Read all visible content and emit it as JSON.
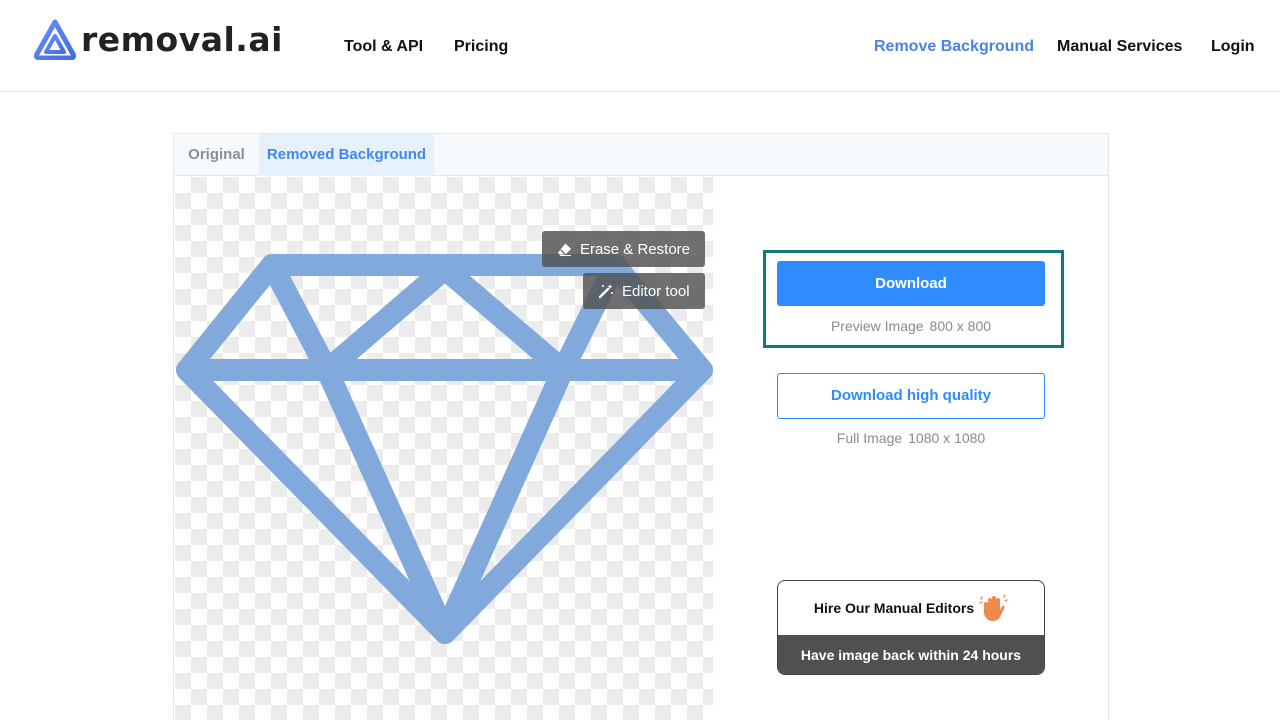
{
  "brand": {
    "logo_text": "removal.ai",
    "accent_color": "#4b82e8"
  },
  "nav": {
    "left": [
      {
        "label": "Tool & API"
      },
      {
        "label": "Pricing"
      }
    ],
    "right": [
      {
        "label": "Remove Background",
        "active": true
      },
      {
        "label": "Manual Services"
      },
      {
        "label": "Login"
      }
    ]
  },
  "tabs": [
    {
      "label": "Original",
      "active": false
    },
    {
      "label": "Removed Background",
      "active": true
    }
  ],
  "preview": {
    "image_description_icon": "diamond-image",
    "subject_color": "#81a9dc",
    "tools": [
      {
        "label": "Erase & Restore",
        "icon": "eraser-icon"
      },
      {
        "label": "Editor tool",
        "icon": "magic-wand-icon"
      }
    ]
  },
  "download": {
    "button_label": "Download",
    "preview_label": "Preview Image",
    "preview_size": "800 x 800",
    "hq_button_label": "Download high quality",
    "full_label": "Full Image",
    "full_size": "1080 x 1080",
    "primary_color": "#2f8cff",
    "highlight_color": "#0e7d79"
  },
  "hire": {
    "title": "Hire Our Manual Editors",
    "icon": "waving-hand-icon",
    "subtitle": "Have image back within 24 hours"
  }
}
